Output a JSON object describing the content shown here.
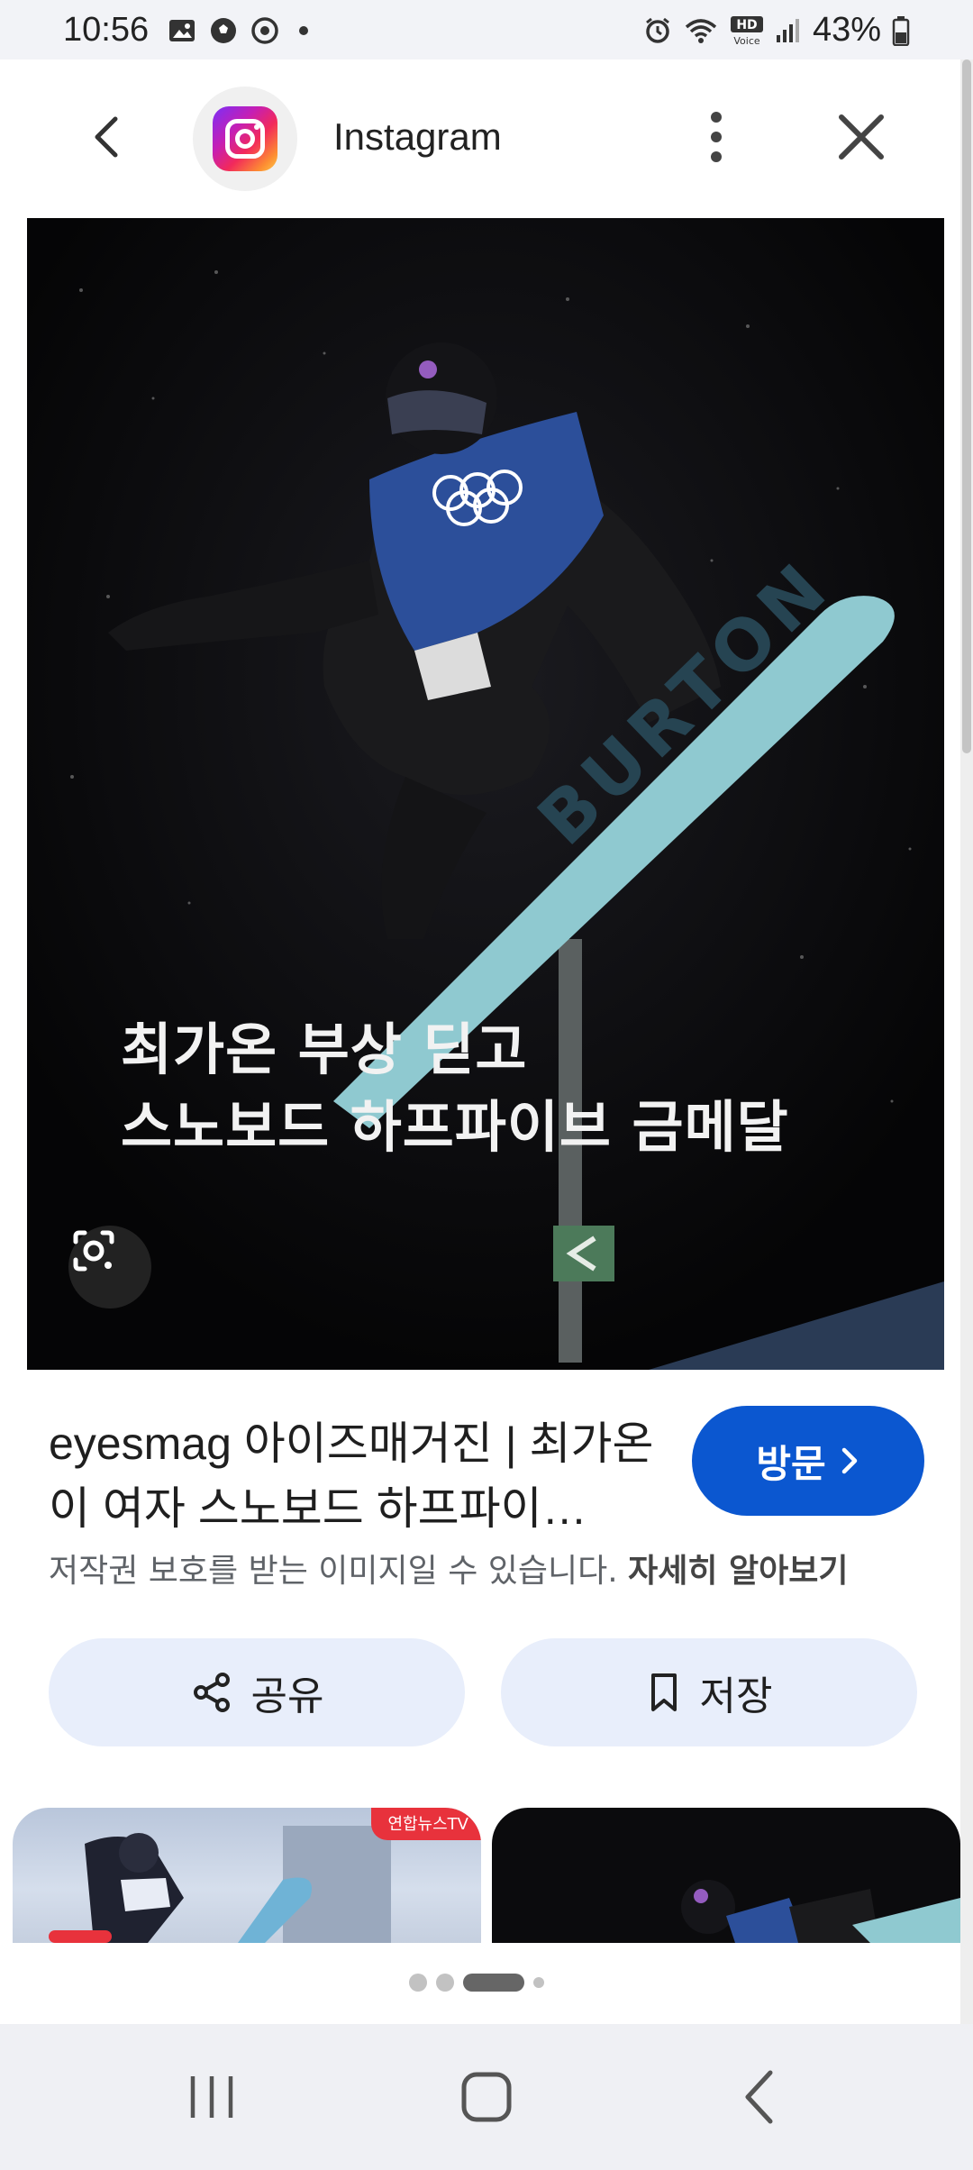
{
  "status_bar": {
    "time": "10:56",
    "battery": "43%",
    "icons_left": [
      "gallery-icon",
      "soccer-icon",
      "instagram-notif-icon",
      "dot-icon"
    ],
    "icons_right": [
      "alarm-icon",
      "wifi-icon",
      "hd-voice-icon",
      "signal-icon",
      "battery-icon"
    ],
    "hd_label": "HD",
    "voice_label": "Voice"
  },
  "header": {
    "title": "Instagram",
    "back_icon": "chevron-left-icon",
    "more_icon": "more-vert-icon",
    "close_icon": "close-icon"
  },
  "main_image": {
    "caption_line1": "최가온 부상 딛고",
    "caption_line2": "스노보드 하프파이브 금메달",
    "board_text": "BURTON",
    "lens_icon": "google-lens-icon"
  },
  "info": {
    "title": "eyesmag 아이즈매거진 | 최가온이 여자 스노보드 하프파이…",
    "visit_label": "방문",
    "copyright_text": "저작권 보호를 받는 이미지일 수 있습니다.",
    "learn_more": "자세히 알아보기"
  },
  "actions": {
    "share_label": "공유",
    "save_label": "저장"
  },
  "related": {
    "badge": "연합뉴스TV"
  },
  "colors": {
    "accent": "#0b57d0",
    "action_bg": "#e8eefb",
    "board": "#8fc9d0"
  }
}
